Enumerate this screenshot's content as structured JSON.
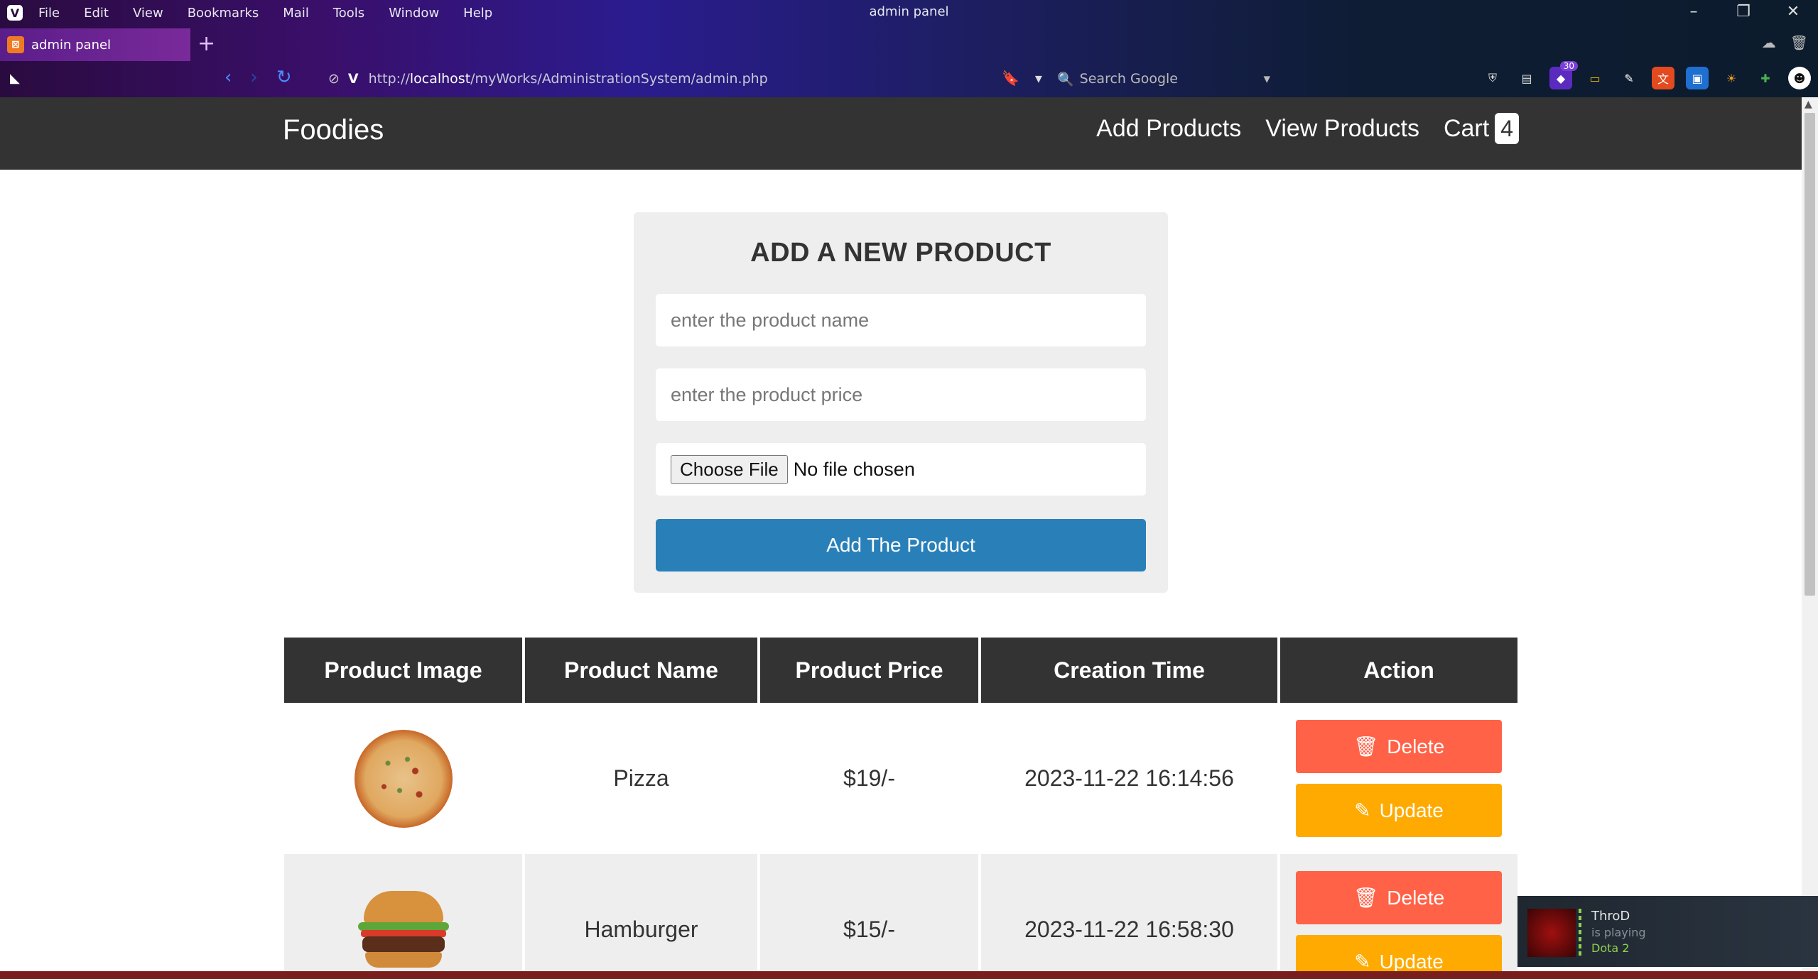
{
  "browser": {
    "menu": [
      "File",
      "Edit",
      "View",
      "Bookmarks",
      "Mail",
      "Tools",
      "Window",
      "Help"
    ],
    "window_title": "admin panel",
    "tab_title": "admin panel",
    "url_prefix": "http://",
    "url_host": "localhost",
    "url_path": "/myWorks/AdministrationSystem/admin.php",
    "search_placeholder": "Search Google",
    "ext_badge": "30"
  },
  "site": {
    "brand": "Foodies",
    "nav": {
      "add": "Add Products",
      "view": "View Products",
      "cart": "Cart",
      "cart_count": "4"
    }
  },
  "form": {
    "title": "ADD A NEW PRODUCT",
    "name_placeholder": "enter the product name",
    "price_placeholder": "enter the product price",
    "file_button": "Choose File",
    "file_status": "No file chosen",
    "submit": "Add The Product"
  },
  "table": {
    "headers": [
      "Product Image",
      "Product Name",
      "Product Price",
      "Creation Time",
      "Action"
    ],
    "rows": [
      {
        "name": "Pizza",
        "price": "$19/-",
        "time": "2023-11-22 16:14:56"
      },
      {
        "name": "Hamburger",
        "price": "$15/-",
        "time": "2023-11-22 16:58:30"
      }
    ],
    "delete_label": "Delete",
    "update_label": "Update"
  },
  "steam": {
    "name": "ThroD",
    "status": "is playing",
    "game": "Dota 2"
  },
  "colors": {
    "header_bg": "#333333",
    "primary": "#2980b9",
    "delete": "#ff6247",
    "update": "#ffaa00"
  }
}
